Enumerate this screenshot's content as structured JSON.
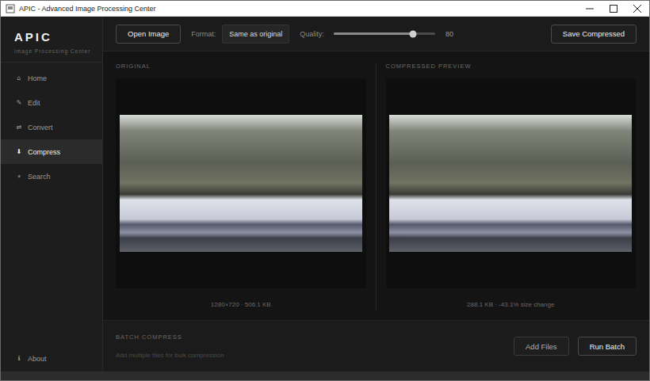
{
  "window": {
    "title": "APIC - Advanced Image Processing Center"
  },
  "sidebar": {
    "logo": "APIC",
    "subtitle": "Image Processing Center",
    "items": [
      {
        "icon": "⌂",
        "label": "Home",
        "selected": false
      },
      {
        "icon": "✎",
        "label": "Edit",
        "selected": false
      },
      {
        "icon": "⇄",
        "label": "Convert",
        "selected": false
      },
      {
        "icon": "⬇",
        "label": "Compress",
        "selected": true
      },
      {
        "icon": "⌕",
        "label": "Search",
        "selected": false
      }
    ],
    "footer": {
      "icon": "ℹ",
      "label": "About"
    }
  },
  "toolbar": {
    "open_button": "Open Image",
    "format_label": "Format:",
    "format_value": "Same as original",
    "quality_label": "Quality:",
    "quality_level": 0.78,
    "quality_value": "80",
    "save_button": "Save Compressed"
  },
  "panels": [
    {
      "title": "ORIGINAL",
      "info": "1280×720 · 506.1 KB"
    },
    {
      "title": "COMPRESSED PREVIEW",
      "info": "288.1 KB · -43.1% size change"
    }
  ],
  "batch": {
    "title": "BATCH COMPRESS",
    "hint": "Add multiple files for bulk compression",
    "buttons": [
      "Add Files",
      "Run Batch"
    ]
  }
}
